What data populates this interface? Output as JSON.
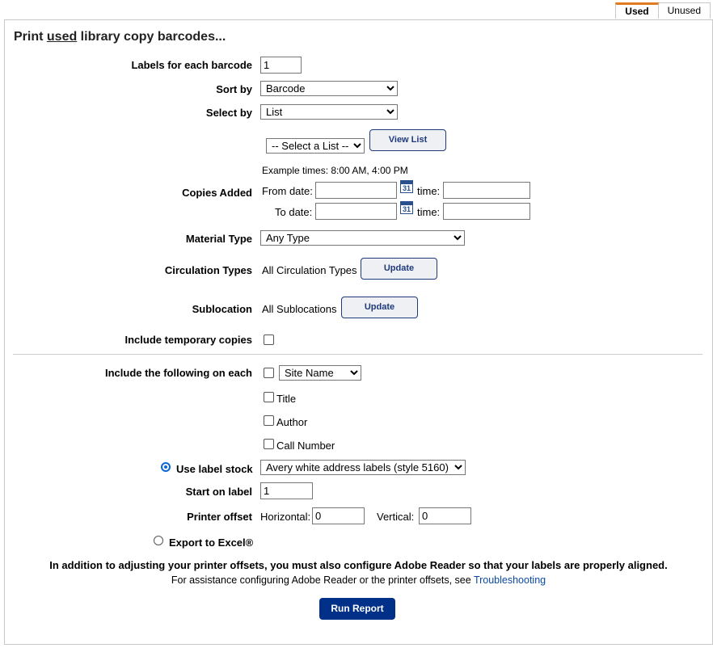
{
  "tabs": [
    {
      "label": "Used",
      "active": true
    },
    {
      "label": "Unused",
      "active": false
    }
  ],
  "title_prefix": "Print ",
  "title_used": "used",
  "title_suffix": " library copy barcodes...",
  "labels_each": {
    "label": "Labels for each barcode",
    "value": "1"
  },
  "sort_by": {
    "label": "Sort by",
    "value": "Barcode"
  },
  "select_by": {
    "label": "Select by",
    "value": "List"
  },
  "list_select": {
    "value": "-- Select a List --"
  },
  "view_list_button": "View List",
  "example_times": "Example times: 8:00 AM, 4:00 PM",
  "copies_added": {
    "label": "Copies Added",
    "from_label": "From date:",
    "to_label": "To date:",
    "time_label": "time:",
    "from_date": "",
    "from_time": "",
    "to_date": "",
    "to_time": ""
  },
  "calendar_icon_text": "31",
  "material_type": {
    "label": "Material Type",
    "value": "Any Type"
  },
  "circulation_types": {
    "label": "Circulation Types",
    "value": "All Circulation Types",
    "button": "Update"
  },
  "sublocation": {
    "label": "Sublocation",
    "value": "All Sublocations",
    "button": "Update"
  },
  "include_temp": {
    "label": "Include temporary copies"
  },
  "include_following": {
    "label": "Include the following on each",
    "site_select": "Site Name",
    "title": "Title",
    "author": "Author",
    "call_number": "Call Number"
  },
  "use_label_stock": {
    "label": "Use label stock",
    "value": "Avery white address labels (style 5160)"
  },
  "start_on_label": {
    "label": "Start on label",
    "value": "1"
  },
  "printer_offset": {
    "label": "Printer offset",
    "horizontal_label": "Horizontal:",
    "horizontal": "0",
    "vertical_label": "Vertical:",
    "vertical": "0"
  },
  "export_excel": {
    "label": "Export to Excel®"
  },
  "note_bold": "In addition to adjusting your printer offsets, you must also configure Adobe Reader so that your labels are properly aligned.",
  "note_help": "For assistance configuring Adobe Reader or the printer offsets, see ",
  "troubleshooting_link": "Troubleshooting",
  "run_report_button": "Run Report",
  "colors": {
    "accent": "#e07b20",
    "primary": "#003087",
    "radio": "#0a66d6"
  }
}
